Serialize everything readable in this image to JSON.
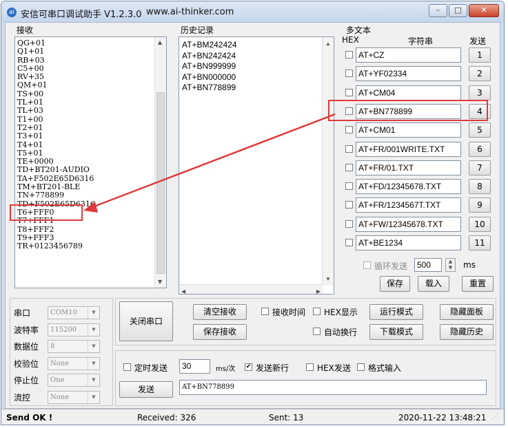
{
  "window": {
    "title": "安信可串口调试助手 V1.2.3.0",
    "url": "www.ai-thinker.com",
    "controls": {
      "minimize": "–",
      "maximize": "□",
      "close": "✕"
    }
  },
  "receive": {
    "label": "接收",
    "lines": [
      "QG+01",
      "Q1+01",
      "RB+03",
      "C5+00",
      "RV+35",
      "QM+01",
      "TS+00",
      "TL+01",
      "TL+03",
      "T1+00",
      "T2+01",
      "T3+01",
      "T4+01",
      "T5+01",
      "TE+0000",
      "TD+BT201-AUDIO",
      "TA+F502E65D6316",
      "TM+BT201-BLE",
      "TN+778899",
      "TD+F502E65D6316",
      "T6+FFF0",
      "T7+FFF1",
      "T8+FFF2",
      "T9+FFF3",
      "TR+0123456789"
    ]
  },
  "history": {
    "label": "历史记录",
    "lines": [
      "AT+BM242424",
      "AT+BN242424",
      "AT+BN999999",
      "AT+BN000000",
      "AT+BN778899"
    ]
  },
  "multitext": {
    "label": "多文本",
    "col_hex": "HEX",
    "col_string": "字符串",
    "col_send": "发送",
    "rows": [
      {
        "text": "AT+CZ",
        "num": "1"
      },
      {
        "text": "AT+YF02334",
        "num": "2"
      },
      {
        "text": "AT+CM04",
        "num": "3"
      },
      {
        "text": "AT+BN778899",
        "num": "4"
      },
      {
        "text": "AT+CM01",
        "num": "5"
      },
      {
        "text": "AT+FR/001WRITE.TXT",
        "num": "6"
      },
      {
        "text": "AT+FR/01.TXT",
        "num": "7"
      },
      {
        "text": "AT+FD/12345678.TXT",
        "num": "8"
      },
      {
        "text": "AT+FR/1234567T.TXT",
        "num": "9"
      },
      {
        "text": "AT+FW/12345678.TXT",
        "num": "10"
      },
      {
        "text": "AT+BE1234",
        "num": "11"
      }
    ],
    "loop_label": "循环发送",
    "loop_value": "500",
    "loop_unit": "ms",
    "save": "保存",
    "load": "载入",
    "reset": "重置"
  },
  "serial": {
    "port_label": "串口",
    "port_value": "COM10",
    "baud_label": "波特率",
    "baud_value": "115200",
    "databits_label": "数据位",
    "databits_value": "8",
    "parity_label": "校验位",
    "parity_value": "None",
    "stopbits_label": "停止位",
    "stopbits_value": "One",
    "flow_label": "流控",
    "flow_value": "None"
  },
  "controls": {
    "close_port": "关闭串口",
    "clear_recv": "清空接收",
    "save_recv": "保存接收",
    "recv_time": "接收时间",
    "hex_display": "HEX显示",
    "auto_wrap": "自动换行",
    "run_mode": "运行模式",
    "download_mode": "下载模式",
    "hide_panel": "隐藏面板",
    "hide_history": "隐藏历史",
    "timed_send": "定时发送",
    "timed_value": "30",
    "timed_unit": "ms/次",
    "send_newline": "发送新行",
    "hex_send": "HEX发送",
    "format_input": "格式输入",
    "send": "发送",
    "send_value": "AT+BN778899",
    "checkmark": "✔"
  },
  "status": {
    "state": "Send OK !",
    "received": "Received: 326",
    "sent": "Sent: 13",
    "datetime": "2020-11-22 13:48:21"
  },
  "colors": {
    "annotation": "#e03a3a",
    "title_bg": "#c5d6ec"
  }
}
